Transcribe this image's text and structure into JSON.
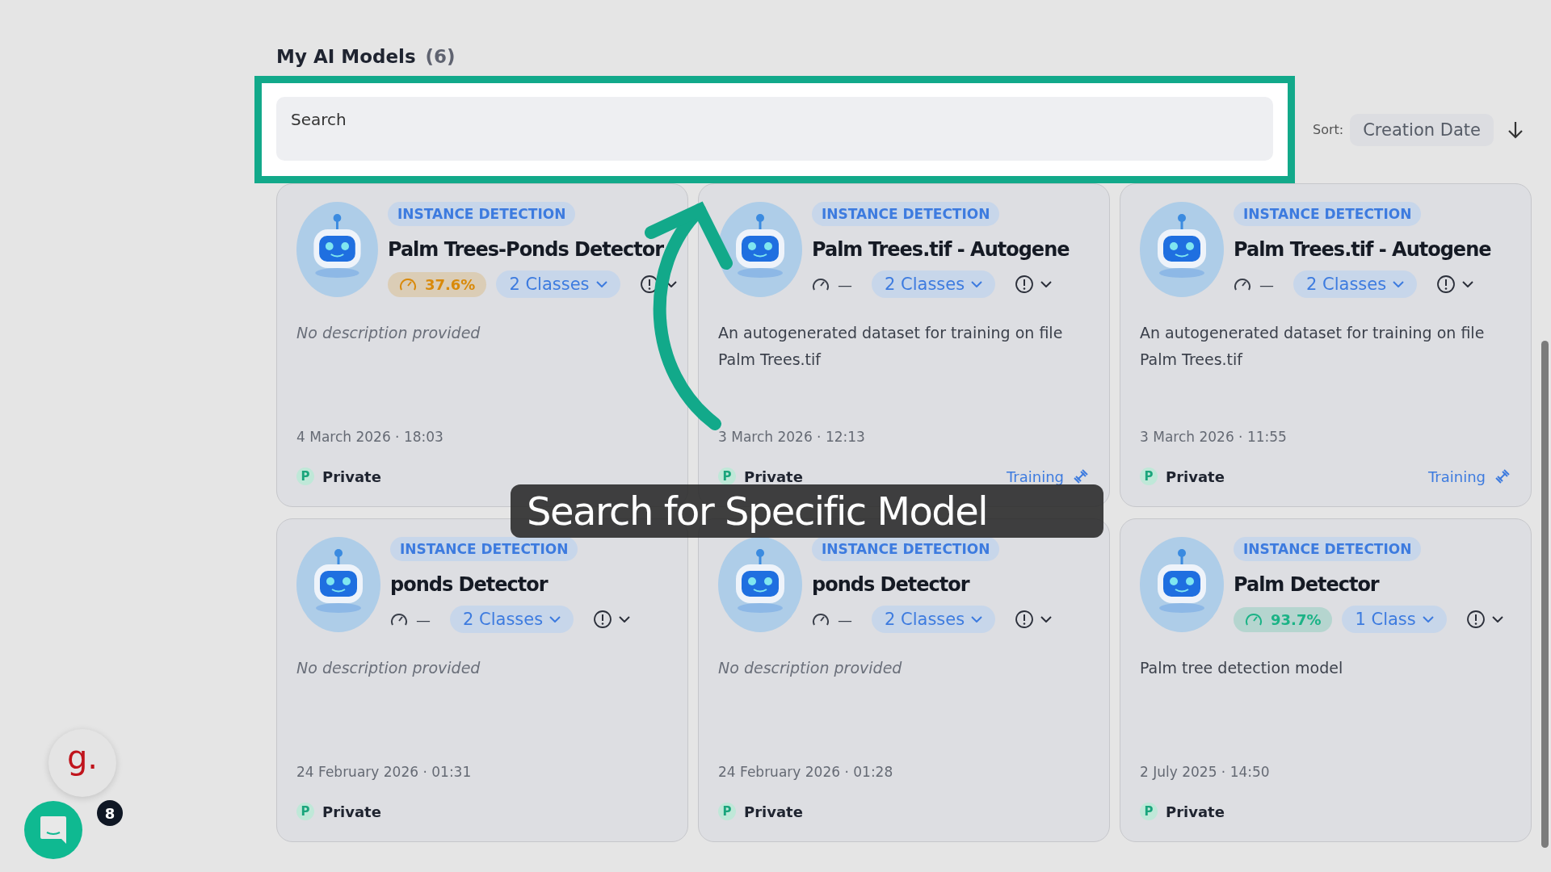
{
  "header": {
    "title": "My AI Models",
    "count": "(6)"
  },
  "search": {
    "placeholder": "Search"
  },
  "sort": {
    "label": "Sort:",
    "value": "Creation Date"
  },
  "models": [
    {
      "type": "INSTANCE DETECTION",
      "name": "Palm Trees-Ponds Detector",
      "accuracy": {
        "kind": "pill",
        "text": "37.6%",
        "color": "#d98a0b"
      },
      "classes": "2 Classes",
      "description": {
        "text": "No description provided",
        "empty": true
      },
      "date": "4 March 2026 · 18:03",
      "visibility": {
        "badge": "P",
        "label": "Private"
      }
    },
    {
      "type": "INSTANCE DETECTION",
      "name": "Palm Trees.tif - Autogene",
      "accuracy": {
        "kind": "plain",
        "text": "—"
      },
      "classes": "2 Classes",
      "description": {
        "text": "An autogenerated dataset for training on file Palm Trees.tif",
        "empty": false
      },
      "date": "3 March 2026 · 12:13",
      "visibility": {
        "badge": "P",
        "label": "Private"
      },
      "status": "Training"
    },
    {
      "type": "INSTANCE DETECTION",
      "name": "Palm Trees.tif - Autogene",
      "accuracy": {
        "kind": "plain",
        "text": "—"
      },
      "classes": "2 Classes",
      "description": {
        "text": "An autogenerated dataset for training on file Palm Trees.tif",
        "empty": false
      },
      "date": "3 March 2026 · 11:55",
      "visibility": {
        "badge": "P",
        "label": "Private"
      },
      "status": "Training"
    },
    {
      "type": "INSTANCE DETECTION",
      "name": "ponds Detector",
      "accuracy": {
        "kind": "plain",
        "text": "—"
      },
      "classes": "2 Classes",
      "description": {
        "text": "No description provided",
        "empty": true
      },
      "date": "24 February 2026 · 01:31",
      "visibility": {
        "badge": "P",
        "label": "Private"
      }
    },
    {
      "type": "INSTANCE DETECTION",
      "name": "ponds Detector",
      "accuracy": {
        "kind": "plain",
        "text": "—"
      },
      "classes": "2 Classes",
      "description": {
        "text": "No description provided",
        "empty": true
      },
      "date": "24 February 2026 · 01:28",
      "visibility": {
        "badge": "P",
        "label": "Private"
      }
    },
    {
      "type": "INSTANCE DETECTION",
      "name": "Palm Detector",
      "accuracy": {
        "kind": "pill",
        "text": "93.7%",
        "color": "#1bb386"
      },
      "classes": "1 Class",
      "description": {
        "text": "Palm tree detection model",
        "empty": false
      },
      "date": "2 July 2025 · 14:50",
      "visibility": {
        "badge": "P",
        "label": "Private"
      }
    }
  ],
  "callout": "Search for Specific Model",
  "widgets": {
    "logo": "g.",
    "badge": "8"
  }
}
